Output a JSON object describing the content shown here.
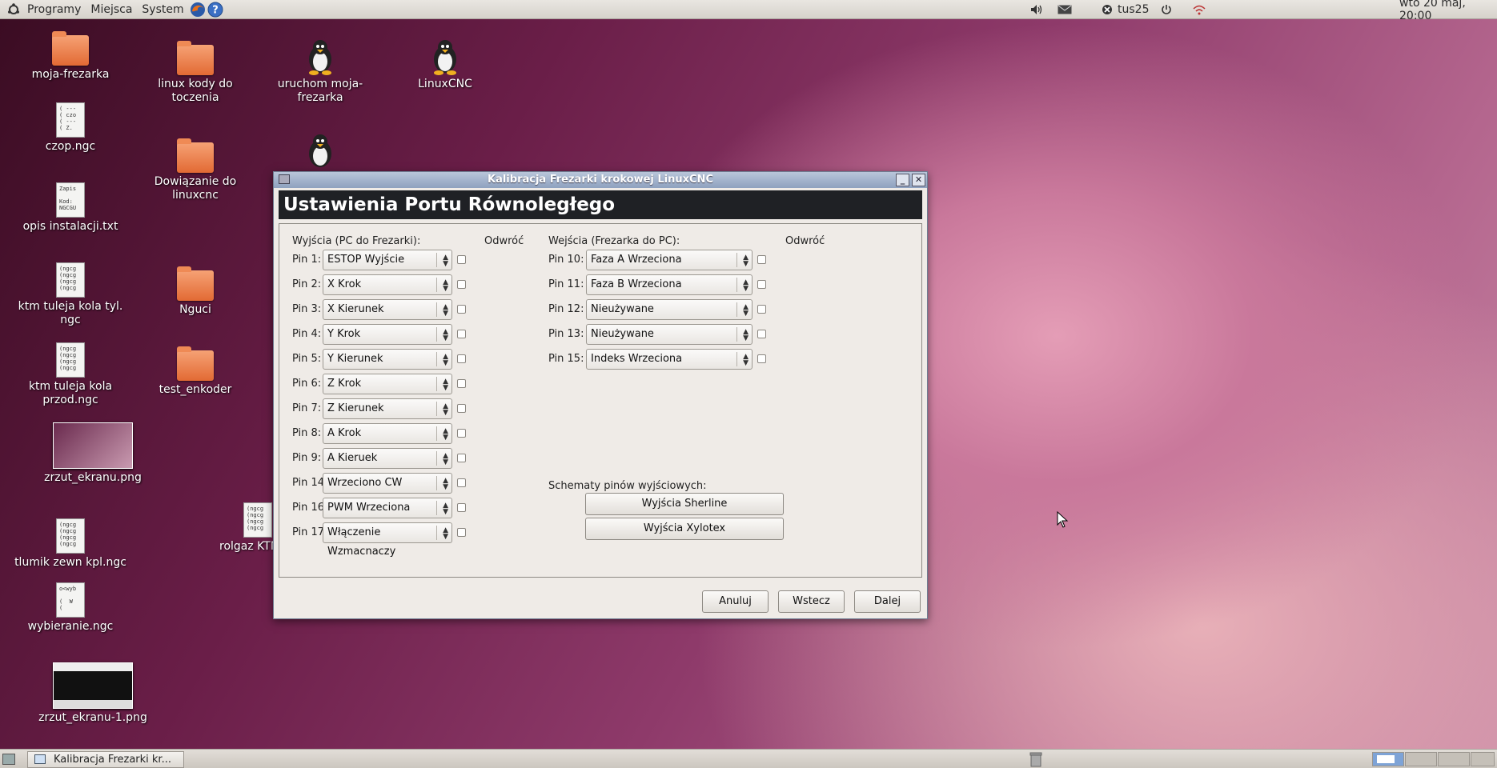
{
  "top_panel": {
    "menus": [
      "Programy",
      "Miejsca",
      "System"
    ],
    "user": "tus25",
    "clock": "wto 20 maj, 20:00"
  },
  "desktop": {
    "icons": [
      {
        "label": "moja-frezarka",
        "type": "folder"
      },
      {
        "label": "czop.ngc",
        "type": "doc",
        "preview": "( ---\n( czo\n( ---\n( Z."
      },
      {
        "label": "opis instalacji.txt",
        "type": "doc",
        "preview": "Zapis\n\nKod:\nNGCGU"
      },
      {
        "label": "ktm tuleja kola tyl.\nngc",
        "type": "doc",
        "preview": "(ngcg\n(ngcg\n(ngcg\n(ngcg"
      },
      {
        "label": "ktm tuleja kola\nprzod.ngc",
        "type": "doc",
        "preview": "(ngcg\n(ngcg\n(ngcg\n(ngcg"
      },
      {
        "label": "zrzut_ekranu.png",
        "type": "thumb"
      },
      {
        "label": "tlumik zewn kpl.ngc",
        "type": "doc",
        "preview": "(ngcg\n(ngcg\n(ngcg\n(ngcg"
      },
      {
        "label": "wybieranie.ngc",
        "type": "doc",
        "preview": "o<wyb\n\n(  W\n("
      },
      {
        "label": "zrzut_ekranu-1.png",
        "type": "thumb"
      },
      {
        "label": "linux kody do\ntoczenia",
        "type": "folder"
      },
      {
        "label": "Dowiązanie do\nlinuxcnc",
        "type": "folder"
      },
      {
        "label": "Nguci",
        "type": "folder"
      },
      {
        "label": "test_enkoder",
        "type": "folder"
      },
      {
        "label": "uruchom moja-\nfrezarka",
        "type": "penguin"
      },
      {
        "label": "LinuxCNC",
        "type": "penguin"
      },
      {
        "label": "rolgaz KTM",
        "type": "doc",
        "preview": "(ngcg\n(ngcg\n(ngcg\n(ngcg"
      }
    ]
  },
  "dialog": {
    "title": "Kalibracja Frezarki krokowej LinuxCNC",
    "header": "Ustawienia Portu Równoległego",
    "outputs_label": "Wyjścia (PC do Frezarki):",
    "invert_label": "Odwróć",
    "inputs_label": "Wejścia (Frezarka do PC):",
    "outputs": [
      {
        "pin": "Pin 1:",
        "value": "ESTOP Wyjście"
      },
      {
        "pin": "Pin 2:",
        "value": "X Krok"
      },
      {
        "pin": "Pin 3:",
        "value": "X Kierunek"
      },
      {
        "pin": "Pin 4:",
        "value": "Y Krok"
      },
      {
        "pin": "Pin 5:",
        "value": "Y Kierunek"
      },
      {
        "pin": "Pin 6:",
        "value": "Z Krok"
      },
      {
        "pin": "Pin 7:",
        "value": "Z Kierunek"
      },
      {
        "pin": "Pin 8:",
        "value": "A Krok"
      },
      {
        "pin": "Pin 9:",
        "value": "A Kieruek"
      },
      {
        "pin": "Pin 14:",
        "value": "Wrzeciono CW"
      },
      {
        "pin": "Pin 16:",
        "value": "PWM Wrzeciona"
      },
      {
        "pin": "Pin 17:",
        "value": "Włączenie Wzmacnaczy"
      }
    ],
    "inputs": [
      {
        "pin": "Pin 10:",
        "value": "Faza A Wrzeciona"
      },
      {
        "pin": "Pin 11:",
        "value": "Faza B Wrzeciona"
      },
      {
        "pin": "Pin 12:",
        "value": "Nieużywane"
      },
      {
        "pin": "Pin 13:",
        "value": "Nieużywane"
      },
      {
        "pin": "Pin 15:",
        "value": "Indeks Wrzeciona"
      }
    ],
    "schemes_label": "Schematy pinów wyjściowych:",
    "sherline_button": "Wyjścia Sherline",
    "xylotex_button": "Wyjścia Xylotex",
    "cancel_button": "Anuluj",
    "back_button": "Wstecz",
    "next_button": "Dalej"
  },
  "bottom_panel": {
    "task_label": "Kalibracja Frezarki kr..."
  }
}
